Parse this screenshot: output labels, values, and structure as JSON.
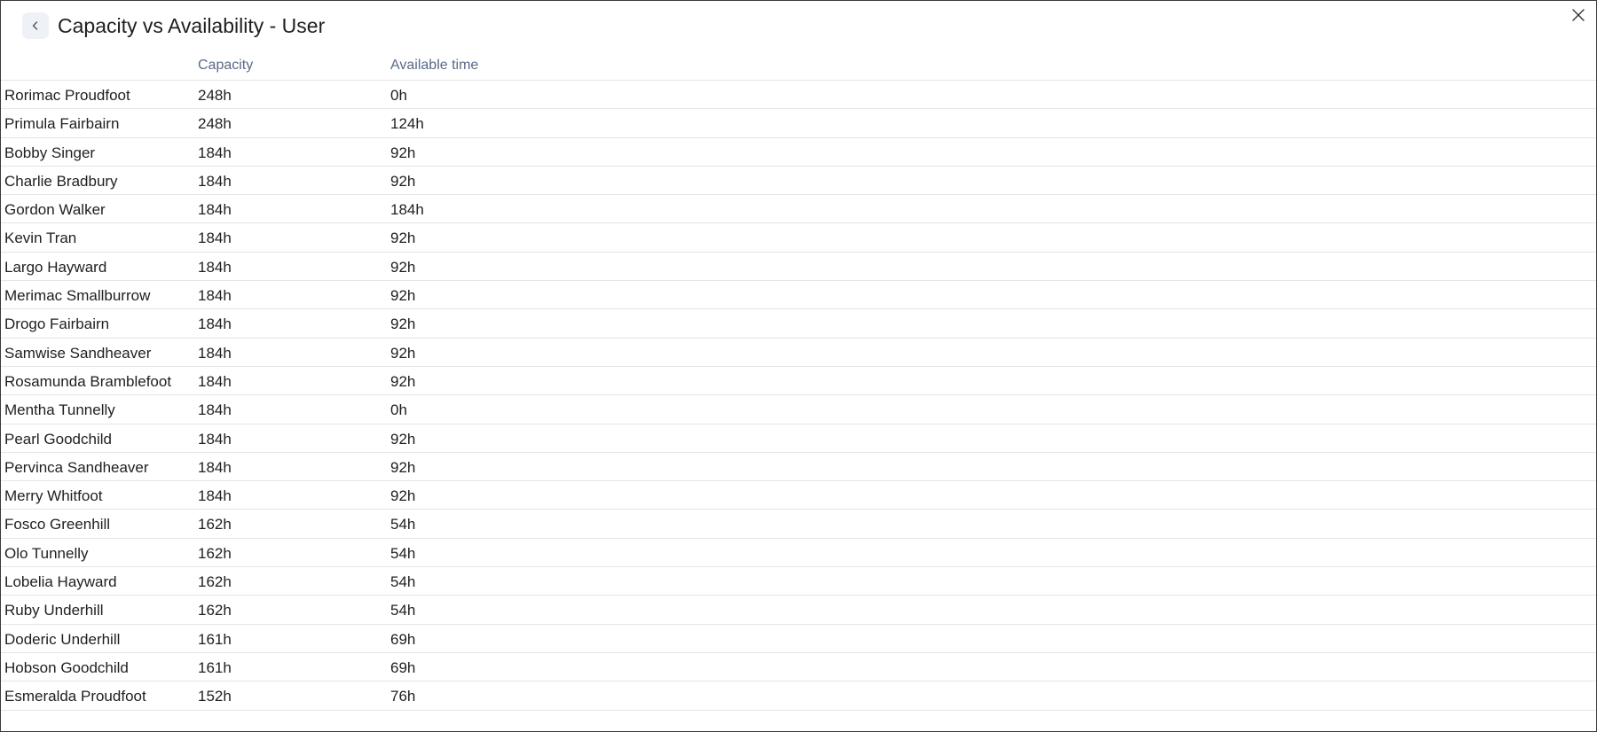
{
  "header": {
    "title": "Capacity vs Availability - User"
  },
  "table": {
    "columns": {
      "capacity": "Capacity",
      "available": "Available time"
    },
    "rows": [
      {
        "name": "Rorimac Proudfoot",
        "capacity": "248h",
        "available": "0h"
      },
      {
        "name": "Primula Fairbairn",
        "capacity": "248h",
        "available": "124h"
      },
      {
        "name": "Bobby Singer",
        "capacity": "184h",
        "available": "92h"
      },
      {
        "name": "Charlie Bradbury",
        "capacity": "184h",
        "available": "92h"
      },
      {
        "name": "Gordon Walker",
        "capacity": "184h",
        "available": "184h"
      },
      {
        "name": "Kevin Tran",
        "capacity": "184h",
        "available": "92h"
      },
      {
        "name": "Largo Hayward",
        "capacity": "184h",
        "available": "92h"
      },
      {
        "name": "Merimac Smallburrow",
        "capacity": "184h",
        "available": "92h"
      },
      {
        "name": "Drogo Fairbairn",
        "capacity": "184h",
        "available": "92h"
      },
      {
        "name": "Samwise Sandheaver",
        "capacity": "184h",
        "available": "92h"
      },
      {
        "name": "Rosamunda Bramblefoot",
        "capacity": "184h",
        "available": "92h"
      },
      {
        "name": "Mentha Tunnelly",
        "capacity": "184h",
        "available": "0h"
      },
      {
        "name": "Pearl Goodchild",
        "capacity": "184h",
        "available": "92h"
      },
      {
        "name": "Pervinca Sandheaver",
        "capacity": "184h",
        "available": "92h"
      },
      {
        "name": "Merry Whitfoot",
        "capacity": "184h",
        "available": "92h"
      },
      {
        "name": "Fosco Greenhill",
        "capacity": "162h",
        "available": "54h"
      },
      {
        "name": "Olo Tunnelly",
        "capacity": "162h",
        "available": "54h"
      },
      {
        "name": "Lobelia Hayward",
        "capacity": "162h",
        "available": "54h"
      },
      {
        "name": "Ruby Underhill",
        "capacity": "162h",
        "available": "54h"
      },
      {
        "name": "Doderic Underhill",
        "capacity": "161h",
        "available": "69h"
      },
      {
        "name": "Hobson Goodchild",
        "capacity": "161h",
        "available": "69h"
      },
      {
        "name": "Esmeralda Proudfoot",
        "capacity": "152h",
        "available": "76h"
      }
    ]
  },
  "icons": {
    "back": "chevron-left-icon",
    "close": "close-icon"
  },
  "colors": {
    "header_text": "#5a6a88",
    "back_button_bg": "#eef1f6",
    "row_divider": "#e5e5e5"
  }
}
